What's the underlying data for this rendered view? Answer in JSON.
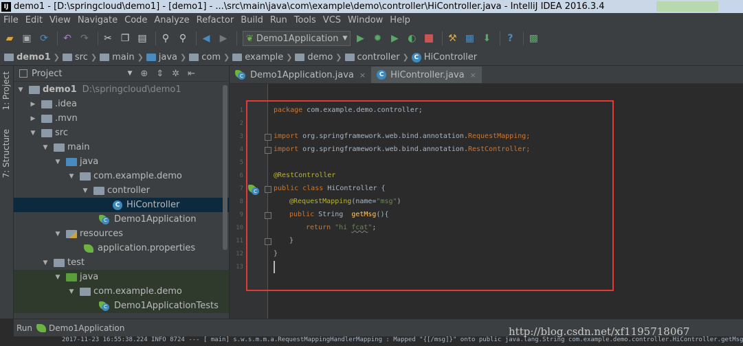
{
  "window": {
    "app_icon": "IJ",
    "title": "demo1 - [D:\\springcloud\\demo1] - [demo1] - ...\\src\\main\\java\\com\\example\\demo\\controller\\HiController.java - IntelliJ IDEA 2016.3.4"
  },
  "menu": [
    "File",
    "Edit",
    "View",
    "Navigate",
    "Code",
    "Analyze",
    "Refactor",
    "Build",
    "Run",
    "Tools",
    "VCS",
    "Window",
    "Help"
  ],
  "toolbar": {
    "run_config": "Demo1Application",
    "icons": [
      "open-icon",
      "save-icon",
      "sync-icon",
      "back-icon",
      "forward-icon",
      "cut-icon",
      "copy-icon",
      "paste-icon",
      "find-icon",
      "replace-icon",
      "nav-back-icon",
      "nav-forward-icon",
      "build-icon",
      "run-icon",
      "debug-icon",
      "coverage-icon",
      "profile-icon",
      "stop-icon",
      "project-structure-icon",
      "sdk-icon",
      "update-icon",
      "help-icon",
      "vcs-icon"
    ]
  },
  "breadcrumb": [
    "demo1",
    "src",
    "main",
    "java",
    "com",
    "example",
    "demo",
    "controller",
    "HiController"
  ],
  "side_tabs": {
    "project": "1: Project",
    "structure": "7: Structure"
  },
  "project_panel": {
    "header": "Project",
    "tree": [
      {
        "label": "demo1",
        "hint": "D:\\springcloud\\demo1"
      },
      {
        "label": ".idea"
      },
      {
        "label": ".mvn"
      },
      {
        "label": "src"
      },
      {
        "label": "main"
      },
      {
        "label": "java"
      },
      {
        "label": "com.example.demo"
      },
      {
        "label": "controller"
      },
      {
        "label": "HiController"
      },
      {
        "label": "Demo1Application"
      },
      {
        "label": "resources"
      },
      {
        "label": "application.properties"
      },
      {
        "label": "test"
      },
      {
        "label": "java"
      },
      {
        "label": "com.example.demo"
      },
      {
        "label": "Demo1ApplicationTests"
      }
    ]
  },
  "editor": {
    "tabs": [
      {
        "label": "Demo1Application.java",
        "active": false
      },
      {
        "label": "HiController.java",
        "active": true
      }
    ],
    "line_numbers": [
      "1",
      "2",
      "3",
      "4",
      "5",
      "6",
      "7",
      "8",
      "9",
      "10",
      "11",
      "12",
      "13"
    ],
    "code": {
      "l1_kw": "package",
      "l1_rest": " com.example.demo.controller;",
      "l3_kw": "import",
      "l3_rest": " org.springframework.web.bind.annotation.",
      "l3_cls": "RequestMapping",
      "l3_end": ";",
      "l4_kw": "import",
      "l4_rest": " org.springframework.web.bind.annotation.",
      "l4_cls": "RestController",
      "l4_end": ";",
      "l6": "@RestController",
      "l7_kw": "public class",
      "l7_rest": " HiController {",
      "l8_ann": "@RequestMapping",
      "l8_p1": "(name=",
      "l8_str": "\"msg\"",
      "l8_p2": ")",
      "l9_kw": "public",
      "l9_type": " String  ",
      "l9_fn": "getMsg",
      "l9_rest": "(){",
      "l10_kw": "return",
      "l10_str1": " \"hi ",
      "l10_str2": "fcat",
      "l10_str3": "\"",
      "l10_end": ";",
      "l11": "}",
      "l12": "}"
    },
    "highlight_color": "#e53935"
  },
  "run_panel": {
    "label": "Run",
    "config": "Demo1Application",
    "console_line": "2017-11-23 16:55:38.224  INFO 8724 --- [           main] s.w.s.m.m.a.RequestMappingHandlerMapping : Mapped \"{[/msg]}\" onto public java.lang.String com.example.demo.controller.HiController.getMsg()"
  },
  "watermark": "http://blog.csdn.net/xf1195718067"
}
